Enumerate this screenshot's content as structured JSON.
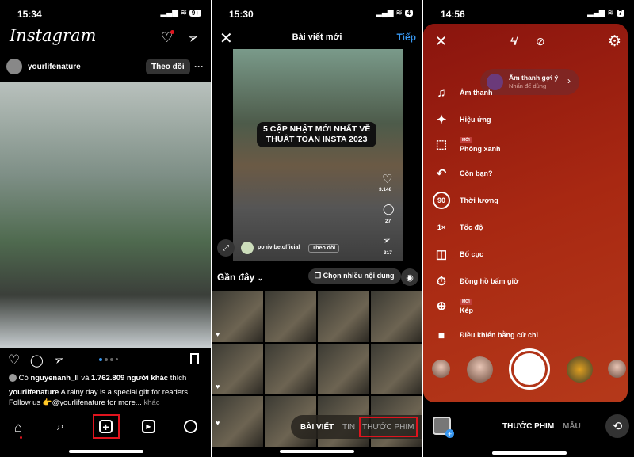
{
  "panel1": {
    "time": "15:34",
    "battery": "9+",
    "logo": "Instagram",
    "post": {
      "username": "yourlifenature",
      "follow_label": "Theo dõi",
      "more": "···",
      "likes_prefix": "Có",
      "liked_by": "nguyenanh_ll",
      "likes_mid": "và",
      "likes_count": "1.762.809 người khác",
      "likes_suffix": "thích",
      "caption_user": "yourlifenature",
      "caption_text": "A rainy day is a special gift for readers.",
      "caption_line2": "Follow us 👉@yourlifenature for more...",
      "more_label": "khác"
    },
    "nav": [
      "home-icon",
      "search-icon",
      "create-icon",
      "reels-icon",
      "profile-icon"
    ],
    "highlight_color": "#e0141e"
  },
  "panel2": {
    "time": "15:30",
    "battery": "4",
    "title": "Bài viết mới",
    "next_label": "Tiếp",
    "preview": {
      "overlay_line1": "5 CẬP NHẬT MỚI NHẤT VỀ",
      "overlay_line2": "THUẬT TOÁN INSTA 2023",
      "likes": "3.148",
      "comments": "27",
      "shares": "317",
      "username": "ponivibe.official",
      "follow_label": "Theo dõi"
    },
    "album_label": "Gần đây",
    "multi_select_label": "Chọn nhiều nội dung",
    "tabs": [
      "BÀI VIẾT",
      "TIN",
      "THƯỚC PHIM"
    ],
    "accent": "#3897f0"
  },
  "panel3": {
    "time": "14:56",
    "battery": "7",
    "sound_suggestion": {
      "title": "Âm thanh gợi ý",
      "subtitle": "Nhấn để dùng"
    },
    "menu": [
      {
        "icon": "music-icon",
        "label": "Âm thanh"
      },
      {
        "icon": "effects-icon",
        "label": "Hiệu ứng"
      },
      {
        "icon": "green-screen-icon",
        "label": "Phông xanh",
        "badge": "MỚI"
      },
      {
        "icon": "reply-icon",
        "label": "Còn bạn?"
      },
      {
        "icon": "duration-icon",
        "label": "Thời lượng",
        "glyph": "90"
      },
      {
        "icon": "speed-icon",
        "label": "Tốc độ",
        "glyph": "1×"
      },
      {
        "icon": "layout-icon",
        "label": "Bố cục"
      },
      {
        "icon": "timer-icon",
        "label": "Đồng hồ bấm giờ"
      },
      {
        "icon": "dual-camera-icon",
        "label": "Kép",
        "badge": "MỚI"
      },
      {
        "icon": "gesture-control-icon",
        "label": "Điều khiển bằng cử chỉ"
      }
    ],
    "modes": [
      "THƯỚC PHIM",
      "MẪU"
    ],
    "bg_color": "#a3200f"
  }
}
